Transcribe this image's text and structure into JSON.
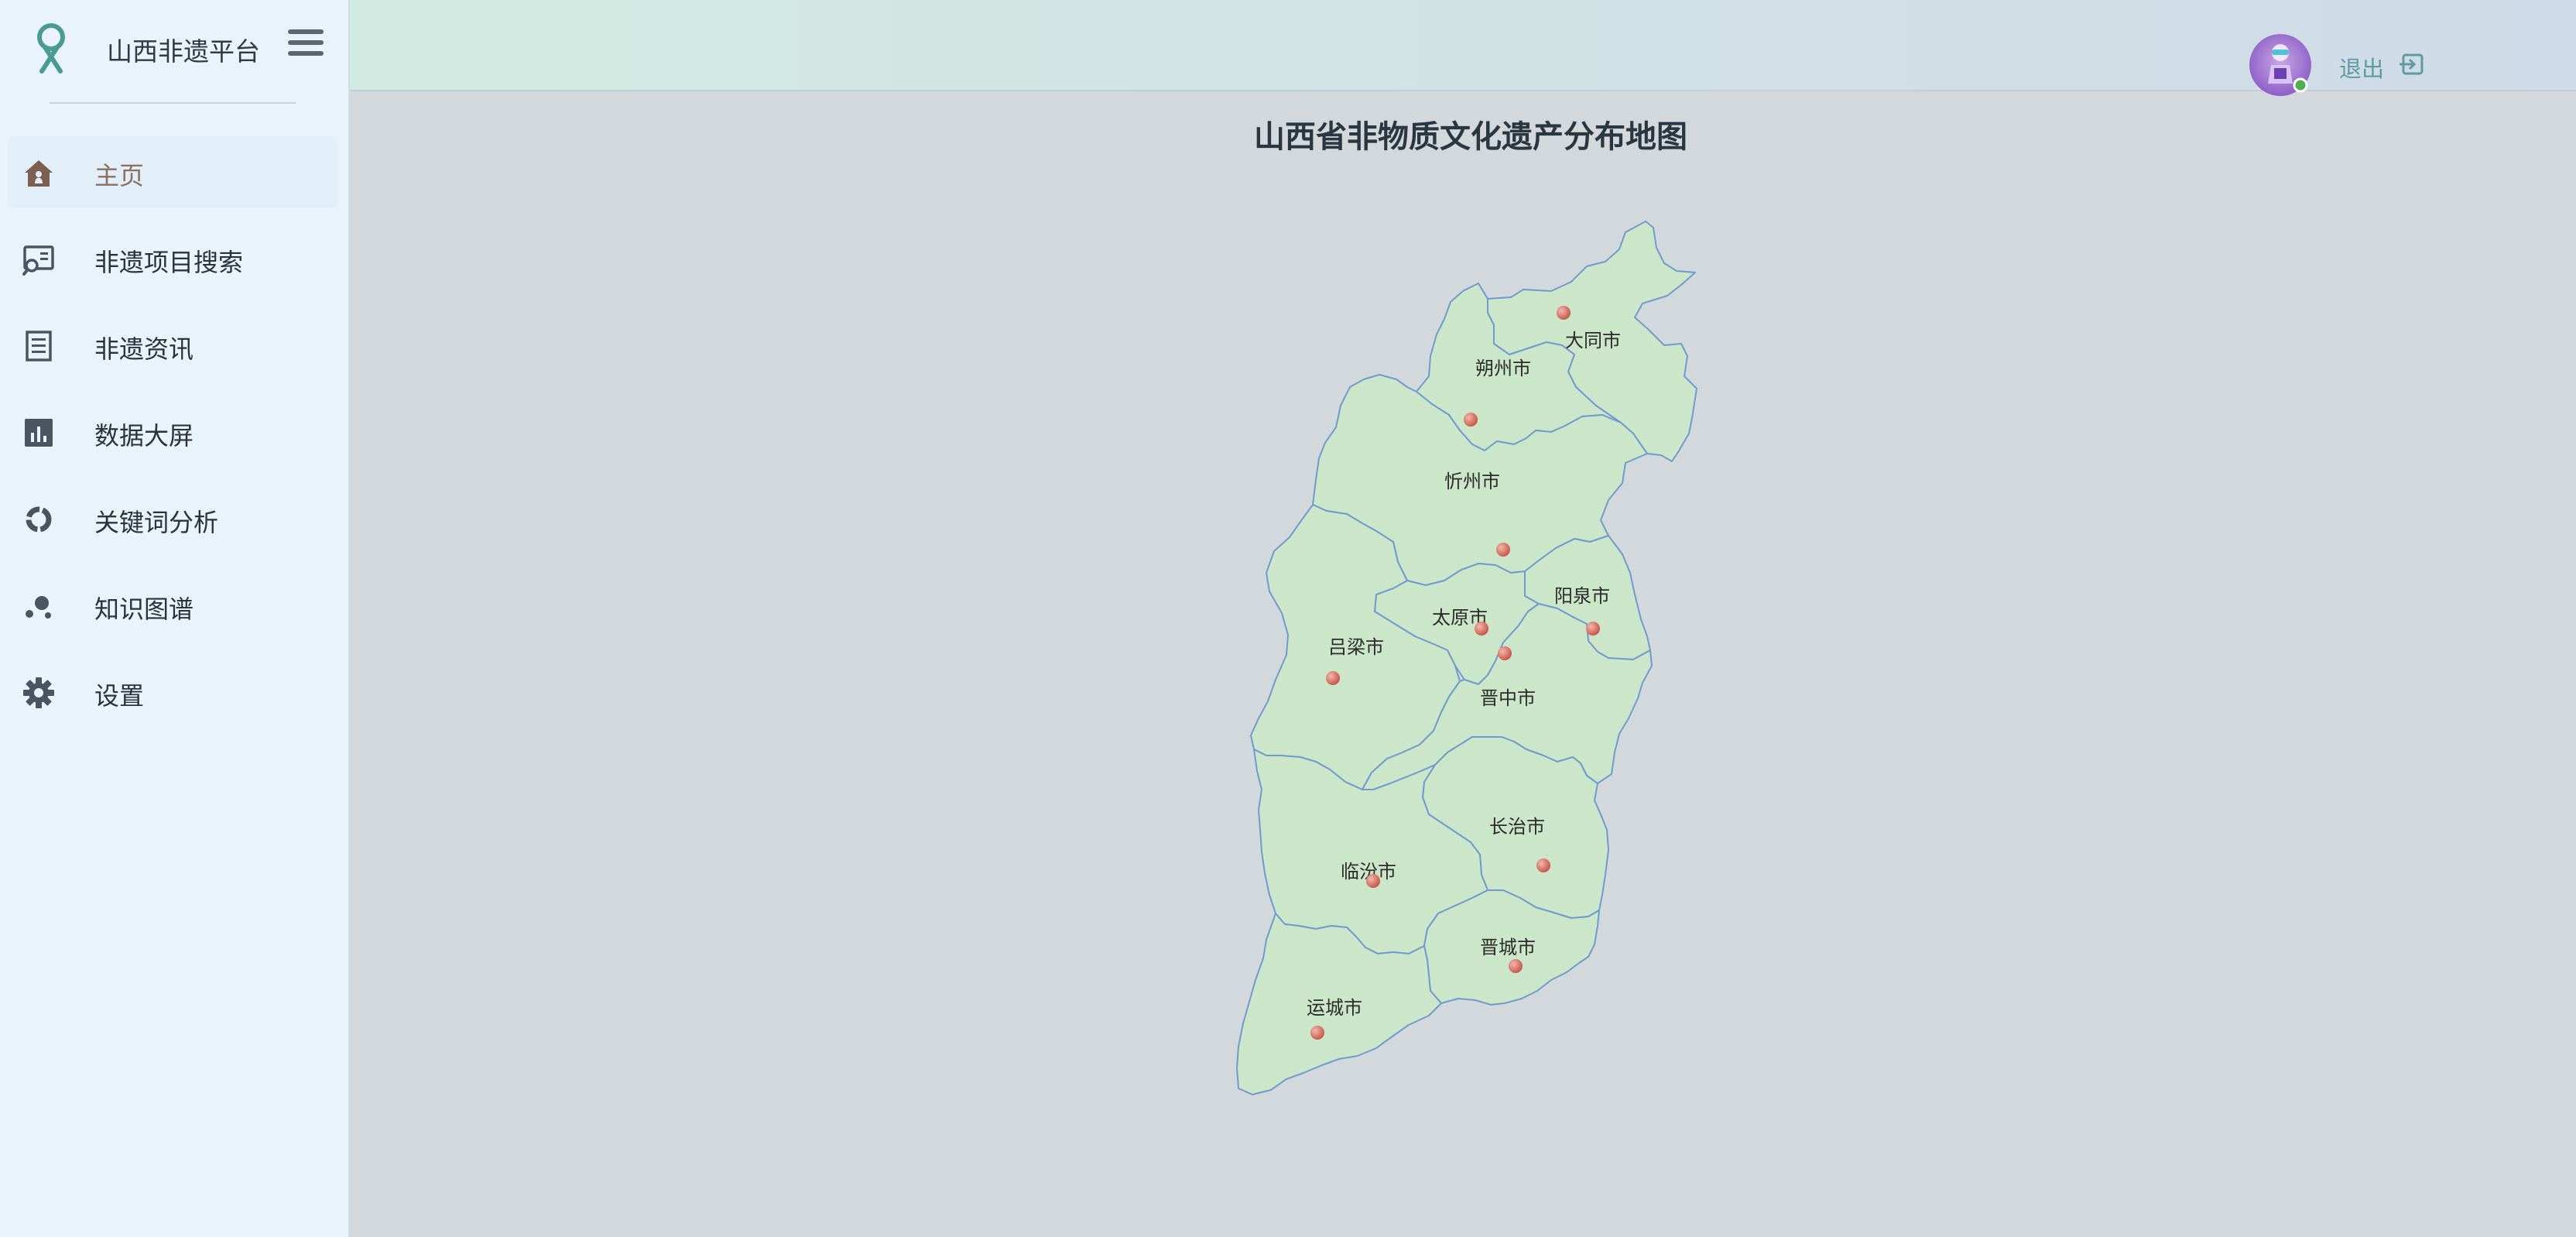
{
  "app": {
    "title": "山西非遗平台"
  },
  "nav": {
    "items": [
      {
        "label": "主页",
        "icon": "home-icon",
        "active": true
      },
      {
        "label": "非遗项目搜索",
        "icon": "search-screen-icon",
        "active": false
      },
      {
        "label": "非遗资讯",
        "icon": "news-icon",
        "active": false
      },
      {
        "label": "数据大屏",
        "icon": "bar-chart-icon",
        "active": false
      },
      {
        "label": "关键词分析",
        "icon": "donut-chart-icon",
        "active": false
      },
      {
        "label": "知识图谱",
        "icon": "graph-nodes-icon",
        "active": false
      },
      {
        "label": "设置",
        "icon": "gear-icon",
        "active": false
      }
    ]
  },
  "header": {
    "logout_label": "退出",
    "avatar_status": "online"
  },
  "map": {
    "title": "山西省非物质文化遗产分布地图",
    "colors": {
      "fill": "#cbe6c8",
      "stroke": "#6f9bd1",
      "marker": "#d9786a"
    },
    "cities": [
      "大同市",
      "朔州市",
      "忻州市",
      "阳泉市",
      "太原市",
      "吕梁市",
      "晋中市",
      "长治市",
      "临汾市",
      "晋城市",
      "运城市"
    ]
  }
}
